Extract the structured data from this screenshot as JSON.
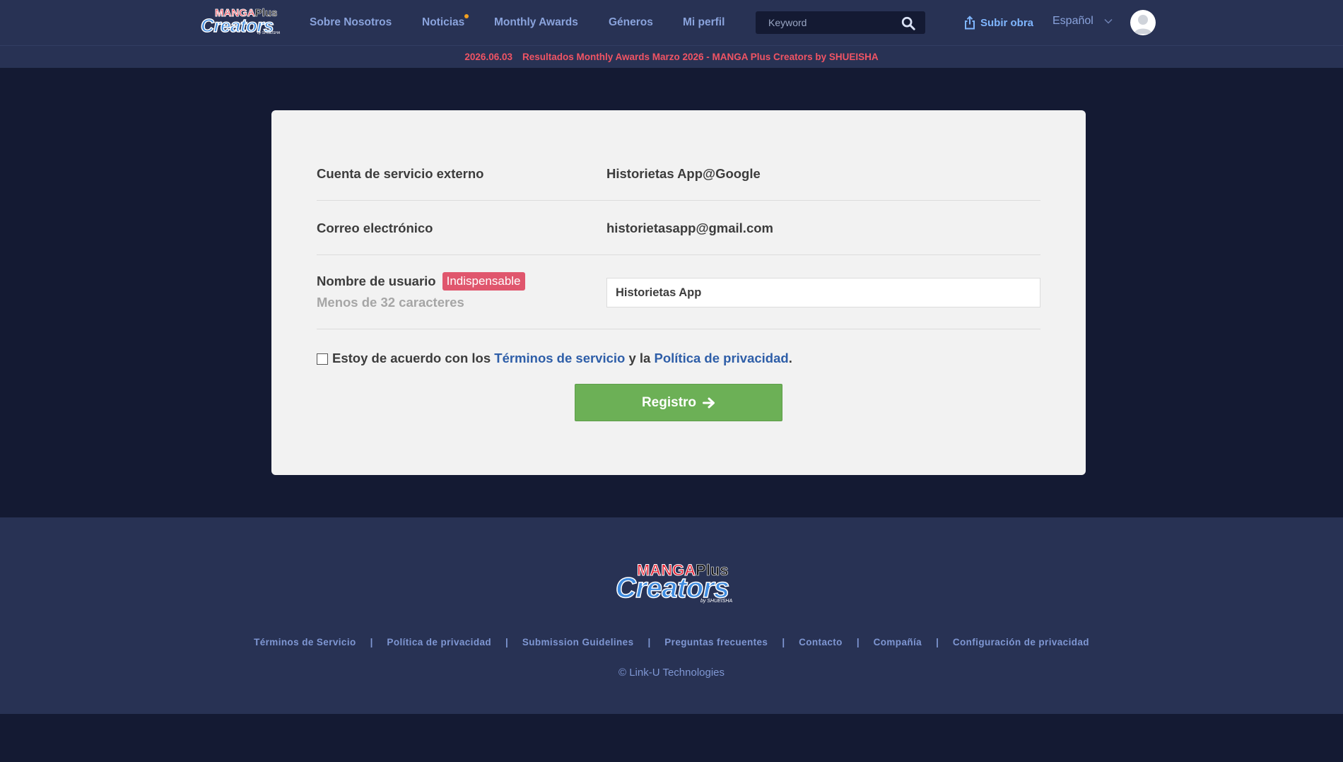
{
  "header": {
    "logo": {
      "top_left": "MANGA",
      "top_right": "Plus",
      "bottom": "Creators",
      "sub": "by SHUEISHA"
    },
    "nav": [
      {
        "label": "Sobre Nosotros"
      },
      {
        "label": "Noticias"
      },
      {
        "label": "Monthly Awards"
      },
      {
        "label": "Géneros"
      },
      {
        "label": "Mi perfil"
      }
    ],
    "search_placeholder": "Keyword",
    "upload_label": "Subir obra",
    "language": "Español"
  },
  "announcement": {
    "date": "2026.06.03",
    "text": "Resultados Monthly Awards Marzo 2026 - MANGA Plus Creators by SHUEISHA"
  },
  "form": {
    "external_account_label": "Cuenta de servicio externo",
    "external_account_value": "Historietas App@Google",
    "email_label": "Correo electrónico",
    "email_value": "historietasapp@gmail.com",
    "username_label": "Nombre de usuario",
    "required_badge": "Indispensable",
    "username_hint": "Menos de 32 caracteres",
    "username_value": "Historietas App",
    "agree_prefix": "Estoy de acuerdo con los ",
    "terms_link": "Términos de servicio",
    "agree_middle": " y la ",
    "privacy_link": "Política de privacidad",
    "agree_suffix": ".",
    "register_label": "Registro"
  },
  "footer": {
    "logo": {
      "top_left": "MANGA",
      "top_right": "Plus",
      "bottom": "Creators",
      "sub": "by SHUEISHA"
    },
    "links": [
      {
        "label": "Términos de Servicio"
      },
      {
        "label": "Política de privacidad"
      },
      {
        "label": "Submission Guidelines"
      },
      {
        "label": "Preguntas frecuentes"
      },
      {
        "label": "Contacto"
      },
      {
        "label": "Compañía"
      },
      {
        "label": "Configuración de privacidad"
      }
    ],
    "copyright": "© Link-U Technologies"
  },
  "colors": {
    "header_bg": "#283254",
    "page_bg": "#141a33",
    "nav_text": "#8aa3dc",
    "announcement_text": "#f15464",
    "badge": "#e0566d",
    "register_button": "#6cb056",
    "link": "#2e5ea8"
  },
  "icons": [
    "search-icon",
    "upload-icon",
    "chevron-down-icon",
    "avatar-icon",
    "arrow-right-icon"
  ]
}
